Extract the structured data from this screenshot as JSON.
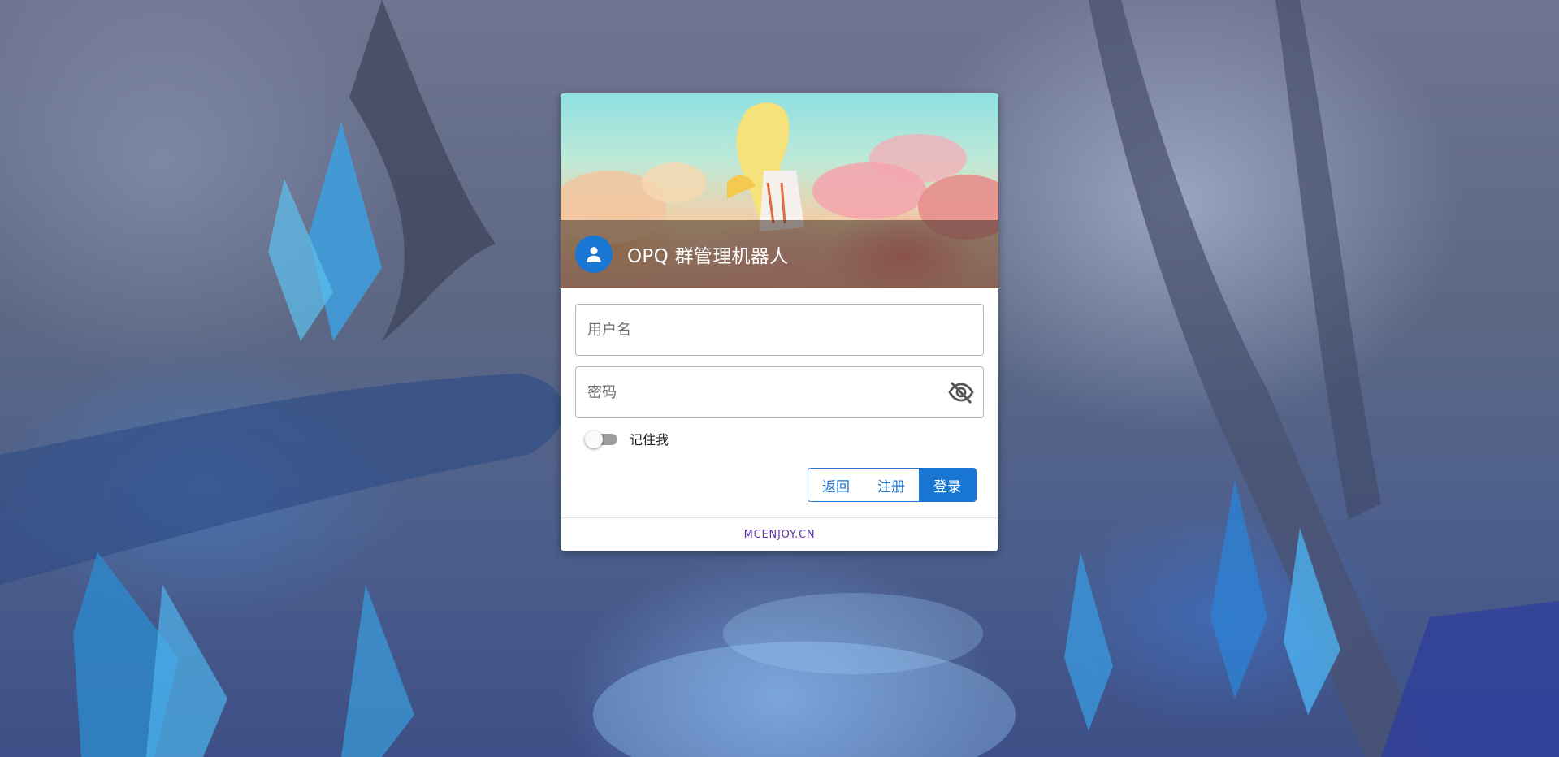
{
  "banner": {
    "title": "OPQ 群管理机器人"
  },
  "form": {
    "username_placeholder": "用户名",
    "password_placeholder": "密码",
    "remember_label": "记住我",
    "remember_checked": false
  },
  "buttons": {
    "back_label": "返回",
    "register_label": "注册",
    "login_label": "登录"
  },
  "footer": {
    "link_text": "MCENJOY.CN"
  },
  "colors": {
    "primary": "#1976d2",
    "footer_link": "#5e35b1"
  }
}
